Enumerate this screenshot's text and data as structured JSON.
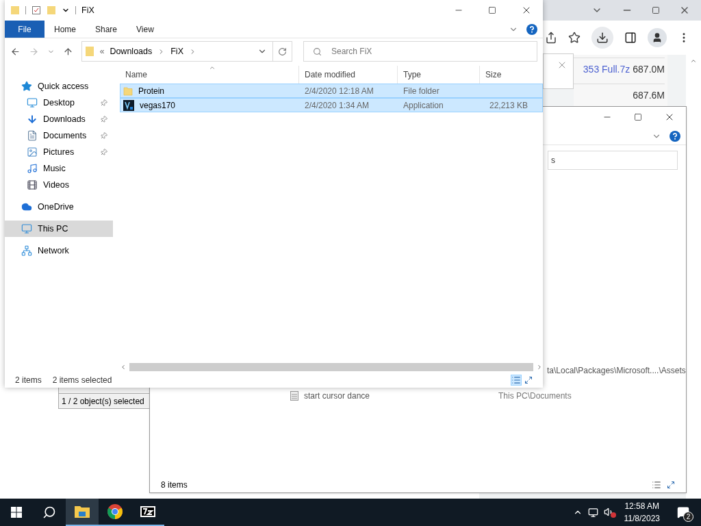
{
  "chrome": {
    "downloads": [
      {
        "name": "353 Full.7z",
        "size": "687.0M"
      },
      {
        "size": "687.6M"
      }
    ]
  },
  "archiver": {
    "status": "1 / 2 object(s) selected"
  },
  "explorer_back": {
    "search_value": "s",
    "path_fragment": "ta\\Local\\Packages\\Microsoft....\\Assets",
    "rows": [
      {
        "name": "start cursor dance",
        "location": "This PC\\Documents"
      }
    ],
    "status": "8 items"
  },
  "explorer": {
    "title": "FiX",
    "ribbon_tabs": [
      {
        "label": "File",
        "kind": "file",
        "selected": false
      },
      {
        "label": "Home",
        "kind": "tab",
        "selected": false
      },
      {
        "label": "Share",
        "kind": "tab",
        "selected": false
      },
      {
        "label": "View",
        "kind": "tab",
        "selected": false
      }
    ],
    "breadcrumb_prefix": "«",
    "breadcrumb": [
      "Downloads",
      "FiX"
    ],
    "search": {
      "placeholder": "Search FiX"
    },
    "nav": [
      {
        "label": "Quick access",
        "kind": "star",
        "selected": false,
        "children": [
          {
            "label": "Desktop",
            "kind": "desktop",
            "pinned": true,
            "selected": false
          },
          {
            "label": "Downloads",
            "kind": "download",
            "pinned": true,
            "selected": false
          },
          {
            "label": "Documents",
            "kind": "document",
            "pinned": true,
            "selected": false
          },
          {
            "label": "Pictures",
            "kind": "picture",
            "pinned": true,
            "selected": false
          },
          {
            "label": "Music",
            "kind": "music",
            "pinned": false,
            "selected": false
          },
          {
            "label": "Videos",
            "kind": "video",
            "pinned": false,
            "selected": false
          }
        ]
      },
      {
        "label": "OneDrive",
        "kind": "cloud",
        "selected": false
      },
      {
        "label": "This PC",
        "kind": "pc",
        "selected": true
      },
      {
        "label": "Network",
        "kind": "network",
        "selected": false
      }
    ],
    "columns": [
      "Name",
      "Date modified",
      "Type",
      "Size"
    ],
    "files": [
      {
        "name": "Protein",
        "date": "2/4/2020 12:18 AM",
        "type": "File folder",
        "kind": "folder",
        "selected": true
      },
      {
        "name": "vegas170",
        "date": "2/4/2020 1:34 AM",
        "type": "Application",
        "size": "22,213 KB",
        "kind": "app",
        "selected": true
      }
    ],
    "status": {
      "count": "2 items",
      "selection": "2 items selected"
    }
  },
  "taskbar": {
    "apps": [
      {
        "kind": "explorer",
        "active": true
      },
      {
        "kind": "chrome",
        "active": false
      },
      {
        "kind": "archiver",
        "active": false
      }
    ],
    "time": "12:58 AM",
    "date": "11/8/2023",
    "notifications": "2"
  }
}
